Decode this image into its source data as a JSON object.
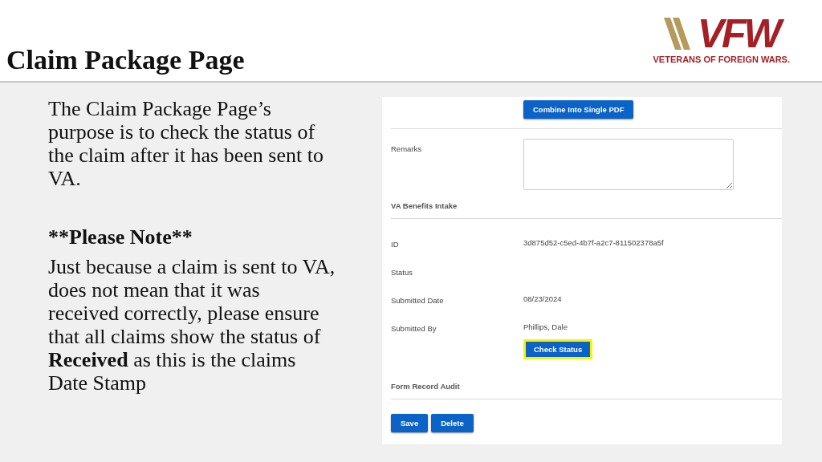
{
  "slide": {
    "title": "Claim Package Page",
    "logo": {
      "mark": "VFW",
      "tagline": "VETERANS OF FOREIGN WARS."
    }
  },
  "notes": [
    {
      "kind": "paragraph",
      "text": "The Claim Package Page’s purpose is to check the status of the claim after it has been sent to VA."
    },
    {
      "kind": "heading",
      "text": "**Please Note**"
    },
    {
      "kind": "paragraph",
      "text": "Just because a claim is sent to VA, does not mean that it was received correctly, please ensure that all claims show the status of **Received** as this is the claims Date Stamp"
    }
  ],
  "form": {
    "rows": [
      {
        "kind": "button",
        "label": "Combine Into Single PDF",
        "highlighted": false
      },
      {
        "kind": "textarea",
        "label": "Remarks"
      },
      {
        "kind": "section",
        "label": "VA Benefits Intake"
      },
      {
        "kind": "field",
        "label": "ID",
        "value": "3d875d52-c5ed-4b7f-a2c7-811502378a5f"
      },
      {
        "kind": "field",
        "label": "Status"
      },
      {
        "kind": "field",
        "label": "Submitted Date",
        "value": "08/23/2024"
      },
      {
        "kind": "field",
        "label": "Submitted By",
        "value": "Phillips, Dale"
      },
      {
        "kind": "button",
        "label": "Check Status",
        "highlighted": true
      },
      {
        "kind": "section",
        "label": "Form Record Audit"
      },
      {
        "kind": "actions",
        "buttons": [
          "Save",
          "Delete"
        ]
      }
    ]
  }
}
